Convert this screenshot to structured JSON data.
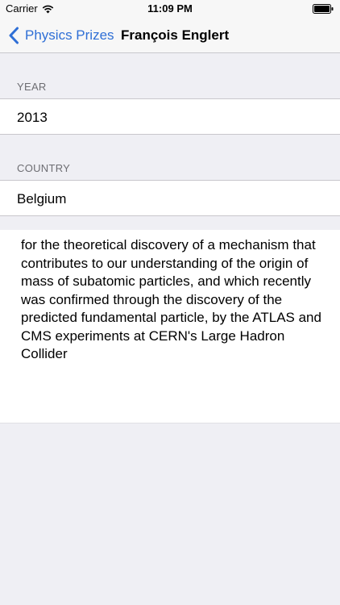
{
  "status_bar": {
    "carrier": "Carrier",
    "time": "11:09 PM",
    "wifi_icon": "wifi-icon",
    "battery_icon": "battery-icon"
  },
  "nav": {
    "back_label": "Physics Prizes",
    "back_icon": "chevron-left-icon",
    "title": "François Englert",
    "accent_color": "#2f6fd6"
  },
  "sections": {
    "year": {
      "header": "YEAR",
      "value": "2013"
    },
    "country": {
      "header": "COUNTRY",
      "value": "Belgium"
    }
  },
  "motivation": "for the theoretical discovery of a mechanism that contributes to our understanding of the origin of mass of subatomic particles, and which recently was confirmed through the discovery of the predicted fundamental particle, by the ATLAS and CMS experiments at CERN's Large Hadron Collider"
}
